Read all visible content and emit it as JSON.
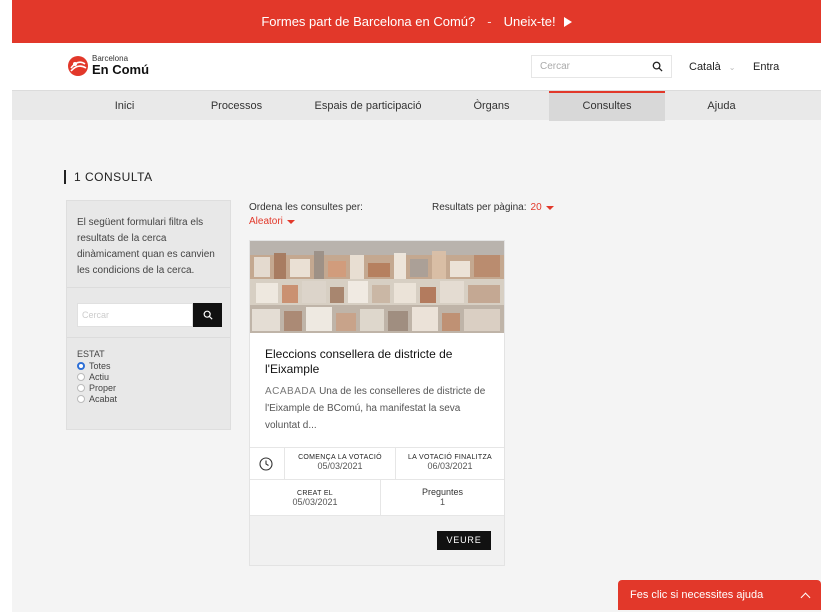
{
  "banner": {
    "text": "Formes part de Barcelona en Comú?",
    "separator": "-",
    "cta": "Uneix-te!"
  },
  "header": {
    "logo_line1": "Barcelona",
    "logo_line2": "En Comú",
    "search_placeholder": "Cercar",
    "language": "Català",
    "login": "Entra"
  },
  "nav": {
    "items": [
      "Inici",
      "Processos",
      "Espais de participació",
      "Òrgans",
      "Consultes",
      "Ajuda"
    ],
    "active": "Consultes"
  },
  "results": {
    "count_label": "1 CONSULTA"
  },
  "filters": {
    "description": "El següent formulari filtra els resultats de la cerca dinàmicament quan es canvien les condicions de la cerca.",
    "search_placeholder": "Cercar",
    "state_title": "ESTAT",
    "options": [
      "Totes",
      "Actiu",
      "Proper",
      "Acabat"
    ],
    "selected": "Totes"
  },
  "sort": {
    "label": "Ordena les consultes per:",
    "value": "Aleatori"
  },
  "per_page": {
    "label": "Resultats per pàgina:",
    "value": "20"
  },
  "card": {
    "title": "Eleccions consellera de districte de l'Eixample",
    "status": "ACABADA",
    "excerpt": "Una de les conselleres de districte de l'Eixample de BComú, ha manifestat la seva voluntat d...",
    "start_label": "COMENÇA LA VOTACIÓ",
    "start_value": "05/03/2021",
    "end_label": "LA VOTACIÓ FINALITZA",
    "end_value": "06/03/2021",
    "created_label": "CREAT EL",
    "created_value": "05/03/2021",
    "questions_label": "Preguntes",
    "questions_value": "1",
    "see_button": "VEURE"
  },
  "help": {
    "text": "Fes clic si necessites ajuda"
  },
  "colors": {
    "brand_red": "#e2382a",
    "radio_blue": "#2d6fd6"
  }
}
